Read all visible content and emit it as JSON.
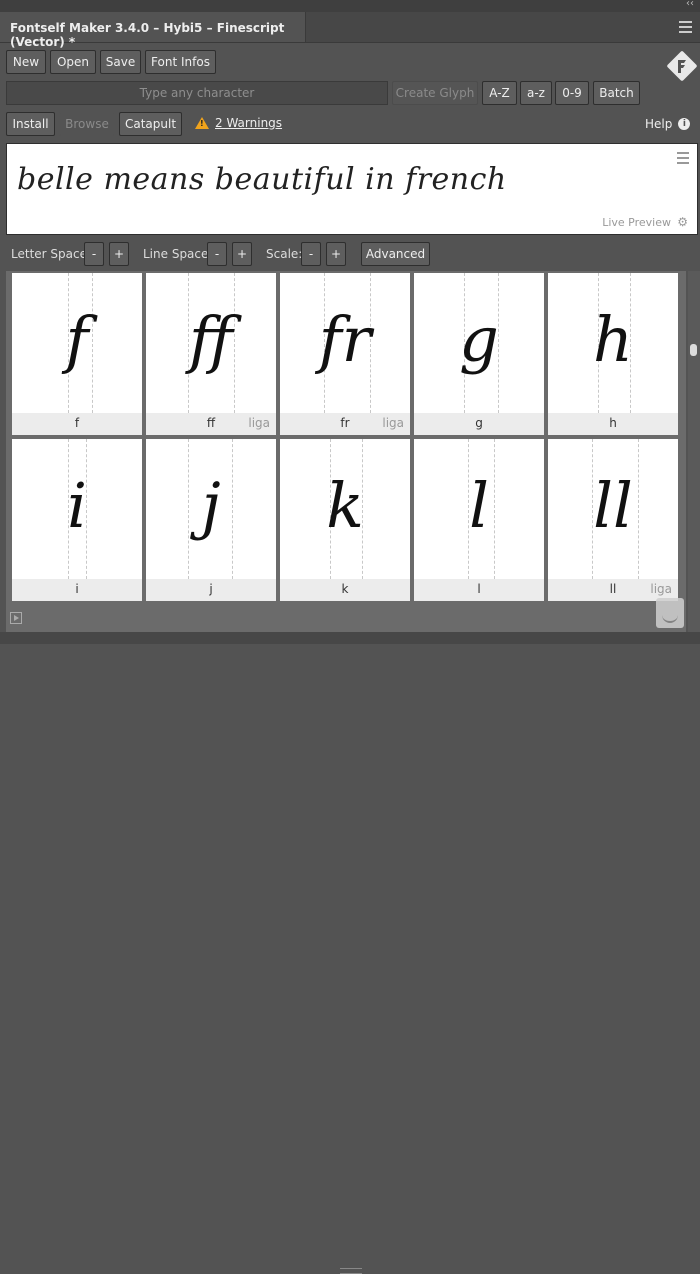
{
  "window": {
    "title": "Fontself Maker 3.4.0 – Hybi5 – Finescript (Vector) *",
    "collapse_glyph": "‹‹"
  },
  "toolbar1": {
    "new": "New",
    "open": "Open",
    "save": "Save",
    "font_infos": "Font Infos"
  },
  "toolbar2": {
    "char_placeholder": "Type any character",
    "create_glyph": "Create Glyph",
    "az_upper": "A-Z",
    "az_lower": "a-z",
    "digits": "0-9",
    "batch": "Batch"
  },
  "toolbar3": {
    "install": "Install",
    "browse": "Browse",
    "catapult": "Catapult",
    "warnings": "2 Warnings",
    "help": "Help"
  },
  "preview": {
    "text": "belle means beautiful in french",
    "live_label": "Live Preview"
  },
  "spacing": {
    "letter_label": "Letter Space:",
    "line_label": "Line Space:",
    "scale_label": "Scale:",
    "minus": "-",
    "plus": "+",
    "advanced": "Advanced"
  },
  "glyphs": [
    {
      "char": "f",
      "name": "f",
      "tag": ""
    },
    {
      "char": "ff",
      "name": "ff",
      "tag": "liga"
    },
    {
      "char": "fr",
      "name": "fr",
      "tag": "liga"
    },
    {
      "char": "g",
      "name": "g",
      "tag": ""
    },
    {
      "char": "h",
      "name": "h",
      "tag": ""
    },
    {
      "char": "i",
      "name": "i",
      "tag": ""
    },
    {
      "char": "j",
      "name": "j",
      "tag": ""
    },
    {
      "char": "k",
      "name": "k",
      "tag": ""
    },
    {
      "char": "l",
      "name": "l",
      "tag": ""
    },
    {
      "char": "ll",
      "name": "ll",
      "tag": "liga"
    }
  ],
  "colors": {
    "panel": "#535353",
    "warning": "#f0a31c",
    "logo": "#e8e8e8"
  },
  "icons": [
    "panel-menu-icon",
    "fontself-logo-icon",
    "warning-icon",
    "info-icon",
    "preview-menu-icon",
    "gear-icon",
    "play-icon",
    "drop-zone-icon"
  ]
}
